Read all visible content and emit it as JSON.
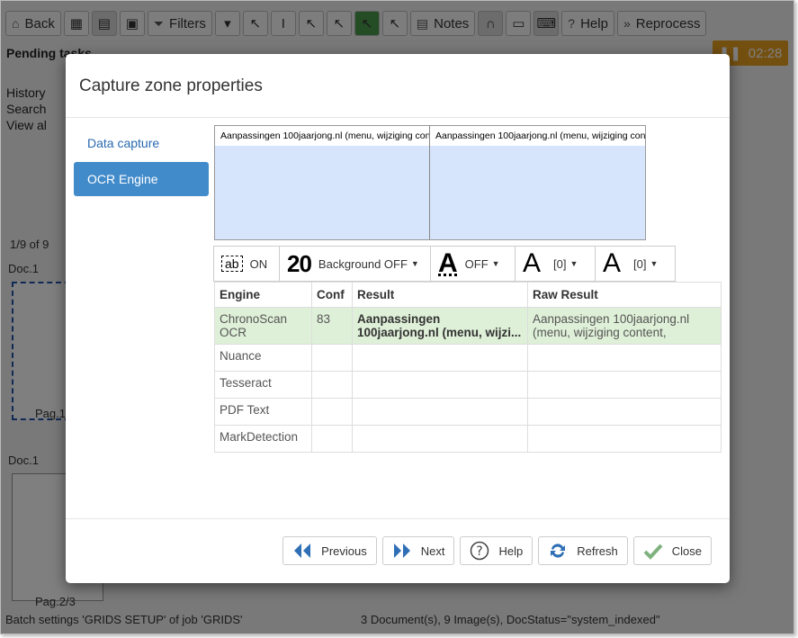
{
  "toolbar": {
    "back": "Back",
    "filters": "Filters",
    "notes": "Notes",
    "help": "Help",
    "reprocess": "Reprocess"
  },
  "timer": "02:28",
  "sidebar": {
    "title": "Pending tasks",
    "history": "History",
    "search": "Search",
    "view_all": "View al",
    "pager": "1/9 of 9",
    "doc1": "Doc.1",
    "doc2": "Doc.1",
    "page1": "Pag.1",
    "page2": "Pag.2/3"
  },
  "status": {
    "left": "Batch settings 'GRIDS SETUP' of job 'GRIDS'",
    "right": "3 Document(s), 9 Image(s), DocStatus=\"system_indexed\""
  },
  "modal": {
    "title": "Capture zone properties",
    "nav": [
      {
        "label": "Data capture",
        "active": false
      },
      {
        "label": "OCR Engine",
        "active": true
      }
    ],
    "preview_text": "Aanpassingen 100jaarjong.nl (menu, wijziging content,",
    "options": {
      "ab_label": "ab",
      "ab_state": "ON",
      "bg_glyph": "20",
      "bg_state": "Background OFF",
      "bold_state": "OFF",
      "size1": "[0]",
      "size2": "[0]"
    },
    "table": {
      "headers": [
        "Engine",
        "Conf",
        "Result",
        "Raw Result"
      ],
      "rows": [
        {
          "engine": "ChronoScan OCR",
          "conf": "83",
          "result": "Aanpassingen 100jaarjong.nl (menu, wijzi...",
          "raw": "Aanpassingen 100jaarjong.nl (menu, wijziging content,",
          "highlight": true
        },
        {
          "engine": "Nuance",
          "conf": "",
          "result": "",
          "raw": ""
        },
        {
          "engine": "Tesseract",
          "conf": "",
          "result": "",
          "raw": ""
        },
        {
          "engine": "PDF Text",
          "conf": "",
          "result": "",
          "raw": ""
        },
        {
          "engine": "MarkDetection",
          "conf": "",
          "result": "",
          "raw": ""
        }
      ]
    },
    "footer": {
      "previous": "Previous",
      "next": "Next",
      "help": "Help",
      "refresh": "Refresh",
      "close": "Close"
    }
  }
}
